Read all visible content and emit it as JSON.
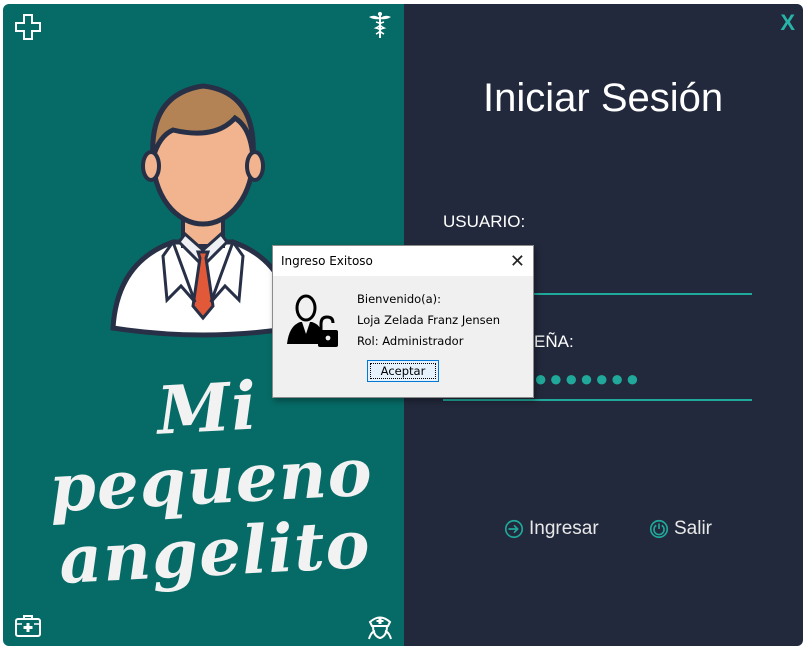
{
  "brand": {
    "line1": "Mi pequeno",
    "line2": "angelito"
  },
  "login": {
    "title": "Iniciar Sesión",
    "user_label": "USUARIO:",
    "password_label_visible": "EÑA:",
    "password_mask": "●●●●●●●",
    "login_button": "Ingresar",
    "exit_button": "Salir",
    "close_button": "X"
  },
  "dialog": {
    "title": "Ingreso Exitoso",
    "line1": "Bienvenido(a):",
    "line2": "Loja Zelada Franz Jensen",
    "line3": "Rol: Administrador",
    "ok_button": "Aceptar",
    "close_glyph": "✕"
  },
  "colors": {
    "left_panel": "#066b66",
    "right_panel": "#22293c",
    "accent": "#20a89a"
  }
}
